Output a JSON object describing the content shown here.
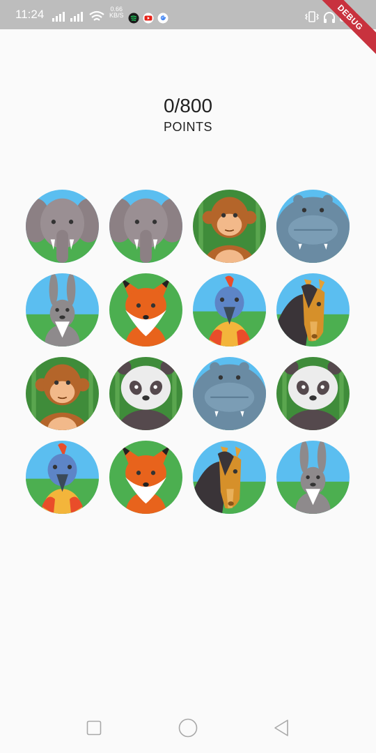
{
  "status_bar": {
    "time": "11:24",
    "net_speed_value": "0.66",
    "net_speed_unit": "KB/S",
    "icons": [
      "signal-icon",
      "signal-icon",
      "wifi-icon",
      "spotify-icon",
      "youtube-icon",
      "google-icon",
      "vibrate-icon",
      "headphones-icon",
      "battery-icon"
    ]
  },
  "debug_banner": "DEBUG",
  "score": {
    "value": "0/800",
    "label": "POINTS"
  },
  "grid": {
    "cards": [
      {
        "animal": "elephant"
      },
      {
        "animal": "elephant"
      },
      {
        "animal": "monkey"
      },
      {
        "animal": "hippo"
      },
      {
        "animal": "rabbit"
      },
      {
        "animal": "fox"
      },
      {
        "animal": "parrot"
      },
      {
        "animal": "horse"
      },
      {
        "animal": "monkey"
      },
      {
        "animal": "panda"
      },
      {
        "animal": "hippo"
      },
      {
        "animal": "panda"
      },
      {
        "animal": "parrot"
      },
      {
        "animal": "fox"
      },
      {
        "animal": "horse"
      },
      {
        "animal": "rabbit"
      }
    ]
  },
  "nav_bar": {
    "icons": [
      "recents-square-icon",
      "home-circle-icon",
      "back-triangle-icon"
    ]
  },
  "colors": {
    "background": "#fafafa",
    "status_bar": "#bdbdbd",
    "sky": "#5bbef0",
    "grass": "#4caf50",
    "debug": "#c8323e"
  }
}
